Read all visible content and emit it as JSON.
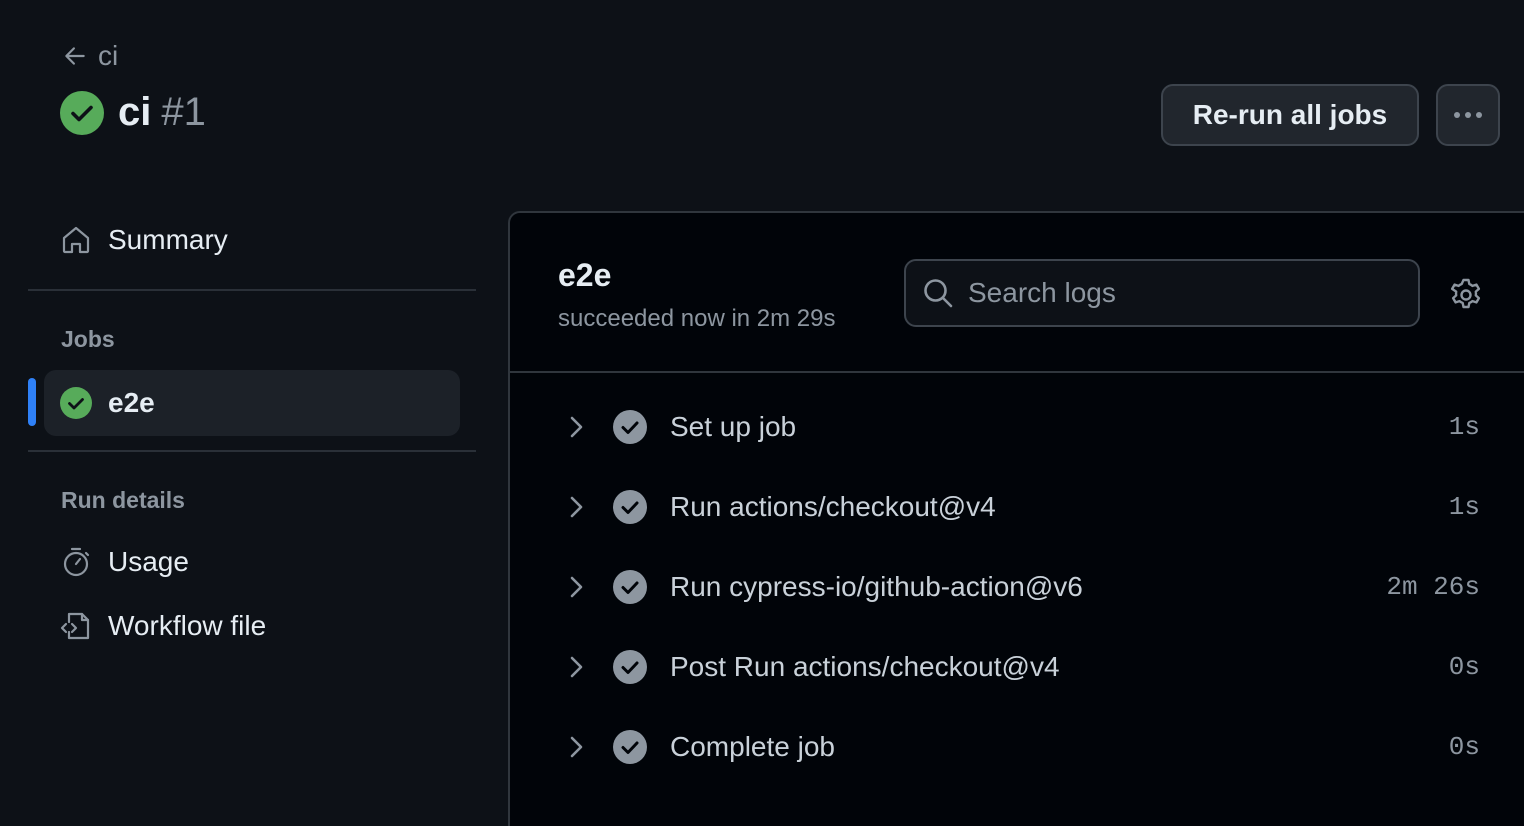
{
  "header": {
    "back_label": "ci",
    "title": "ci",
    "run_number": "#1",
    "rerun_label": "Re-run all jobs"
  },
  "sidebar": {
    "summary_label": "Summary",
    "jobs_heading": "Jobs",
    "jobs": [
      {
        "label": "e2e",
        "status": "success"
      }
    ],
    "run_details_heading": "Run details",
    "usage_label": "Usage",
    "workflow_file_label": "Workflow file"
  },
  "job_panel": {
    "title": "e2e",
    "subtitle": "succeeded now in 2m 29s",
    "search_placeholder": "Search logs",
    "steps": [
      {
        "label": "Set up job",
        "duration": "1s"
      },
      {
        "label": "Run actions/checkout@v4",
        "duration": "1s"
      },
      {
        "label": "Run cypress-io/github-action@v6",
        "duration": "2m 26s"
      },
      {
        "label": "Post Run actions/checkout@v4",
        "duration": "0s"
      },
      {
        "label": "Complete job",
        "duration": "0s"
      }
    ]
  },
  "colors": {
    "background": "#0d1117",
    "success": "#57ab5a",
    "accent": "#2f81f7",
    "muted": "#8d96a0"
  }
}
